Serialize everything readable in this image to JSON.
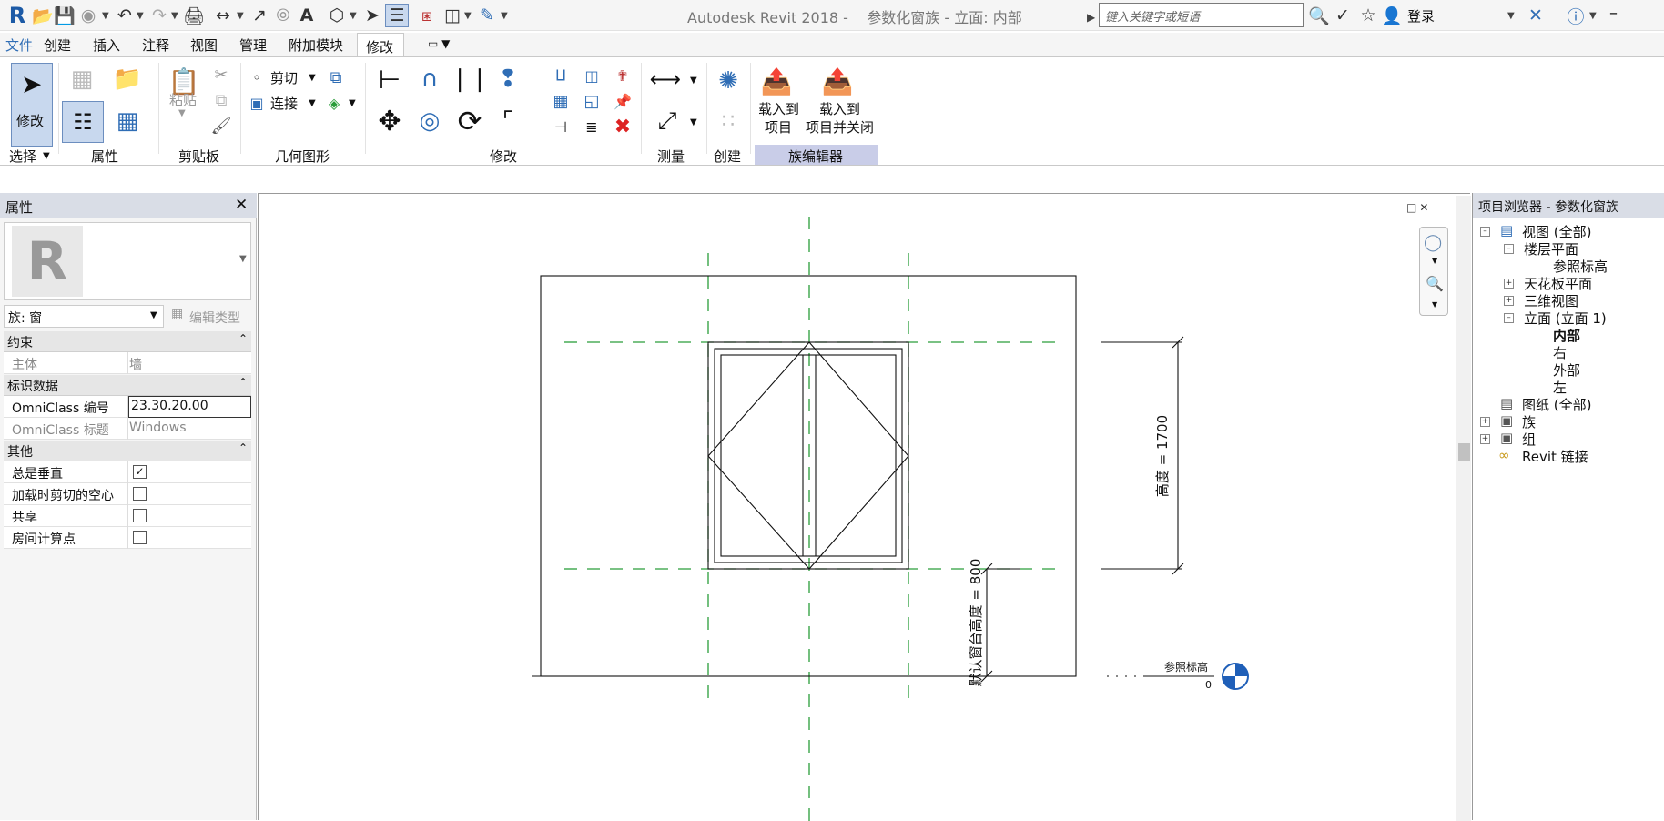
{
  "app": {
    "title": "Autodesk Revit 2018 -",
    "document": "参数化窗族 - 立面: 内部",
    "search_placeholder": "键入关键字或短语",
    "login": "登录"
  },
  "tabs": [
    "文件",
    "创建",
    "插入",
    "注释",
    "视图",
    "管理",
    "附加模块",
    "修改"
  ],
  "ribbon": {
    "modify_label": "修改",
    "paste_label": "粘贴",
    "cut_label": "剪切",
    "join_label": "连接",
    "load_project_line1": "载入到",
    "load_project_line2": "项目",
    "load_close_line1": "载入到",
    "load_close_line2": "项目并关闭",
    "panels": {
      "select": "选择",
      "properties": "属性",
      "clipboard": "剪贴板",
      "geometry": "几何图形",
      "modify": "修改",
      "measure": "测量",
      "create": "创建",
      "family_editor": "族编辑器"
    }
  },
  "properties": {
    "title": "属性",
    "family_type": "族: 窗",
    "edit_type": "编辑类型",
    "groups": {
      "constraints": "约束",
      "identity": "标识数据",
      "other": "其他"
    },
    "rows": {
      "host_key": "主体",
      "host_val": "墙",
      "omni_num_key": "OmniClass 编号",
      "omni_num_val": "23.30.20.00",
      "omni_title_key": "OmniClass 标题",
      "omni_title_val": "Windows",
      "always_vertical_key": "总是垂直",
      "cut_void_key": "加载时剪切的空心",
      "shared_key": "共享",
      "room_calc_key": "房间计算点"
    },
    "checks": {
      "always_vertical": true,
      "cut_void": false,
      "shared": false,
      "room_calc": false
    }
  },
  "drawing": {
    "height_dim": "高度 = 1700",
    "sill_dim": "默认窗台高度 = 800",
    "level_name": "参照标高",
    "level_value": "0"
  },
  "browser": {
    "title": "项目浏览器 - 参数化窗族",
    "items": {
      "views": "视图 (全部)",
      "floor_plans": "楼层平面",
      "ref_level": "参照标高",
      "ceiling_plans": "天花板平面",
      "views_3d": "三维视图",
      "elevations": "立面 (立面 1)",
      "interior": "内部",
      "right": "右",
      "exterior": "外部",
      "left": "左",
      "sheets": "图纸 (全部)",
      "families": "族",
      "groups": "组",
      "revit_links": "Revit 链接"
    }
  },
  "colors": {
    "accent": "#2f6db5",
    "ref_plane": "#2a9d3a",
    "panel_highlight": "#c9cde8"
  }
}
